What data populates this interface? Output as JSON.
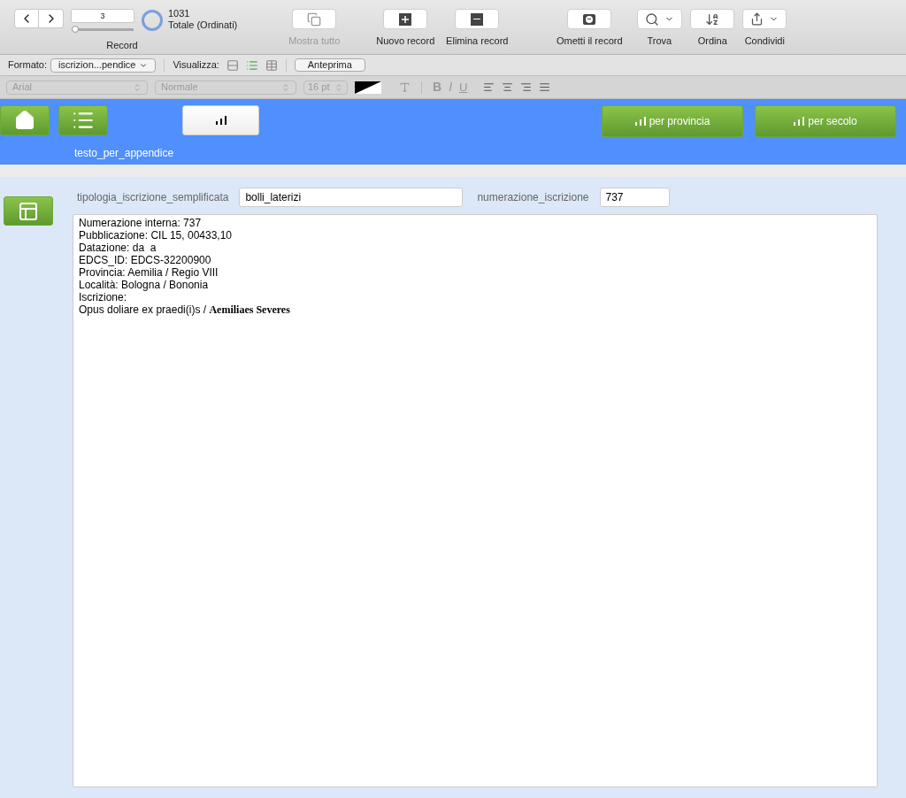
{
  "toolbar": {
    "record_field": "3",
    "record_slider": {
      "level": 0.04
    },
    "found_count": "1031",
    "total_label": "Totale (Ordinati)",
    "record_label": "Record",
    "buttons": [
      {
        "kind": "show_all",
        "label": "Mostra tutto",
        "disabled": true
      },
      {
        "kind": "new",
        "label": "Nuovo record",
        "disabled": false
      },
      {
        "kind": "delete",
        "label": "Elimina record",
        "disabled": false
      },
      {
        "kind": "omit",
        "label": "Ometti il record",
        "disabled": false
      },
      {
        "kind": "find",
        "label": "Trova",
        "disabled": false
      },
      {
        "kind": "sort",
        "label": "Ordina",
        "disabled": false
      },
      {
        "kind": "share",
        "label": "Condividi",
        "disabled": false
      }
    ]
  },
  "format_bar": {
    "format_label": "Formato:",
    "format_value": "iscrizion...pendice",
    "view_label": "Visualizza:",
    "views": [
      {
        "kind": "form",
        "selected": false
      },
      {
        "kind": "list",
        "selected": true
      },
      {
        "kind": "table",
        "selected": false
      }
    ],
    "preview_button": "Anteprima"
  },
  "text_bar": {
    "font": "Arial",
    "style": "Normale",
    "size": "16 pt",
    "bold": "B",
    "italic": "I",
    "underline": "U"
  },
  "header": {
    "layout_name": "testo_per_appendice",
    "nav_buttons": [
      {
        "kind": "home"
      },
      {
        "kind": "list"
      }
    ],
    "report_buttons": [
      {
        "label": "per provincia"
      },
      {
        "label": "per secolo"
      }
    ]
  },
  "record": {
    "fields": [
      {
        "label": "tipologia_iscrizione_semplificata",
        "value": "bolli_laterizi"
      },
      {
        "label": "numerazione_iscrizione",
        "value": "737"
      }
    ],
    "text_lines": [
      "Numerazione interna: 737",
      "Pubblicazione: CIL 15, 00433,10",
      "Datazione: da  a",
      "EDCS_ID: EDCS-32200900",
      "Provincia: Aemilia / Regio VIII",
      "Località: Bologna / Bononia",
      "Iscrizione:",
      "Opus doliare ex praedi(i)s / **Aemiliaes Severes**"
    ]
  }
}
